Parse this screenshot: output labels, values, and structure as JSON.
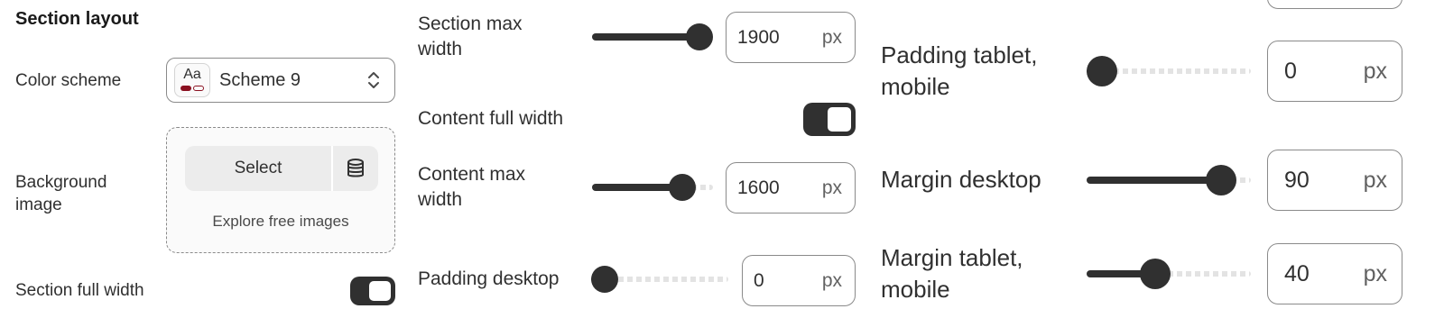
{
  "left": {
    "heading": "Section layout",
    "color_scheme": {
      "label": "Color scheme",
      "swatch_text": "Aa",
      "value": "Scheme 9",
      "swatch_color": "#8a1020"
    },
    "background_image": {
      "label_line1": "Background",
      "label_line2": "image",
      "select_label": "Select",
      "explore_label": "Explore free images"
    },
    "section_full_width": {
      "label": "Section full width",
      "on": true
    }
  },
  "middle": {
    "section_max_width": {
      "label_line1": "Section max",
      "label_line2": "width",
      "value": "1900",
      "unit": "px",
      "fill": 1.0
    },
    "content_full_width": {
      "label": "Content full width",
      "on": true
    },
    "content_max_width": {
      "label_line1": "Content max",
      "label_line2": "width",
      "value": "1600",
      "unit": "px",
      "fill": 0.82
    },
    "padding_desktop": {
      "label": "Padding desktop",
      "value": "0",
      "unit": "px",
      "fill": 0.0
    }
  },
  "right": {
    "padding_tablet_mobile": {
      "label_line1": "Padding tablet,",
      "label_line2": "mobile",
      "value": "0",
      "unit": "px",
      "fill": 0.0
    },
    "margin_desktop": {
      "label": "Margin desktop",
      "value": "90",
      "unit": "px",
      "fill": 0.89
    },
    "margin_tablet_mobile": {
      "label_line1": "Margin tablet,",
      "label_line2": "mobile",
      "value": "40",
      "unit": "px",
      "fill": 0.4
    }
  },
  "colors": {
    "accent_dark": "#303030",
    "border": "#8a8a8a",
    "track_rest": "#e3e3e3"
  }
}
